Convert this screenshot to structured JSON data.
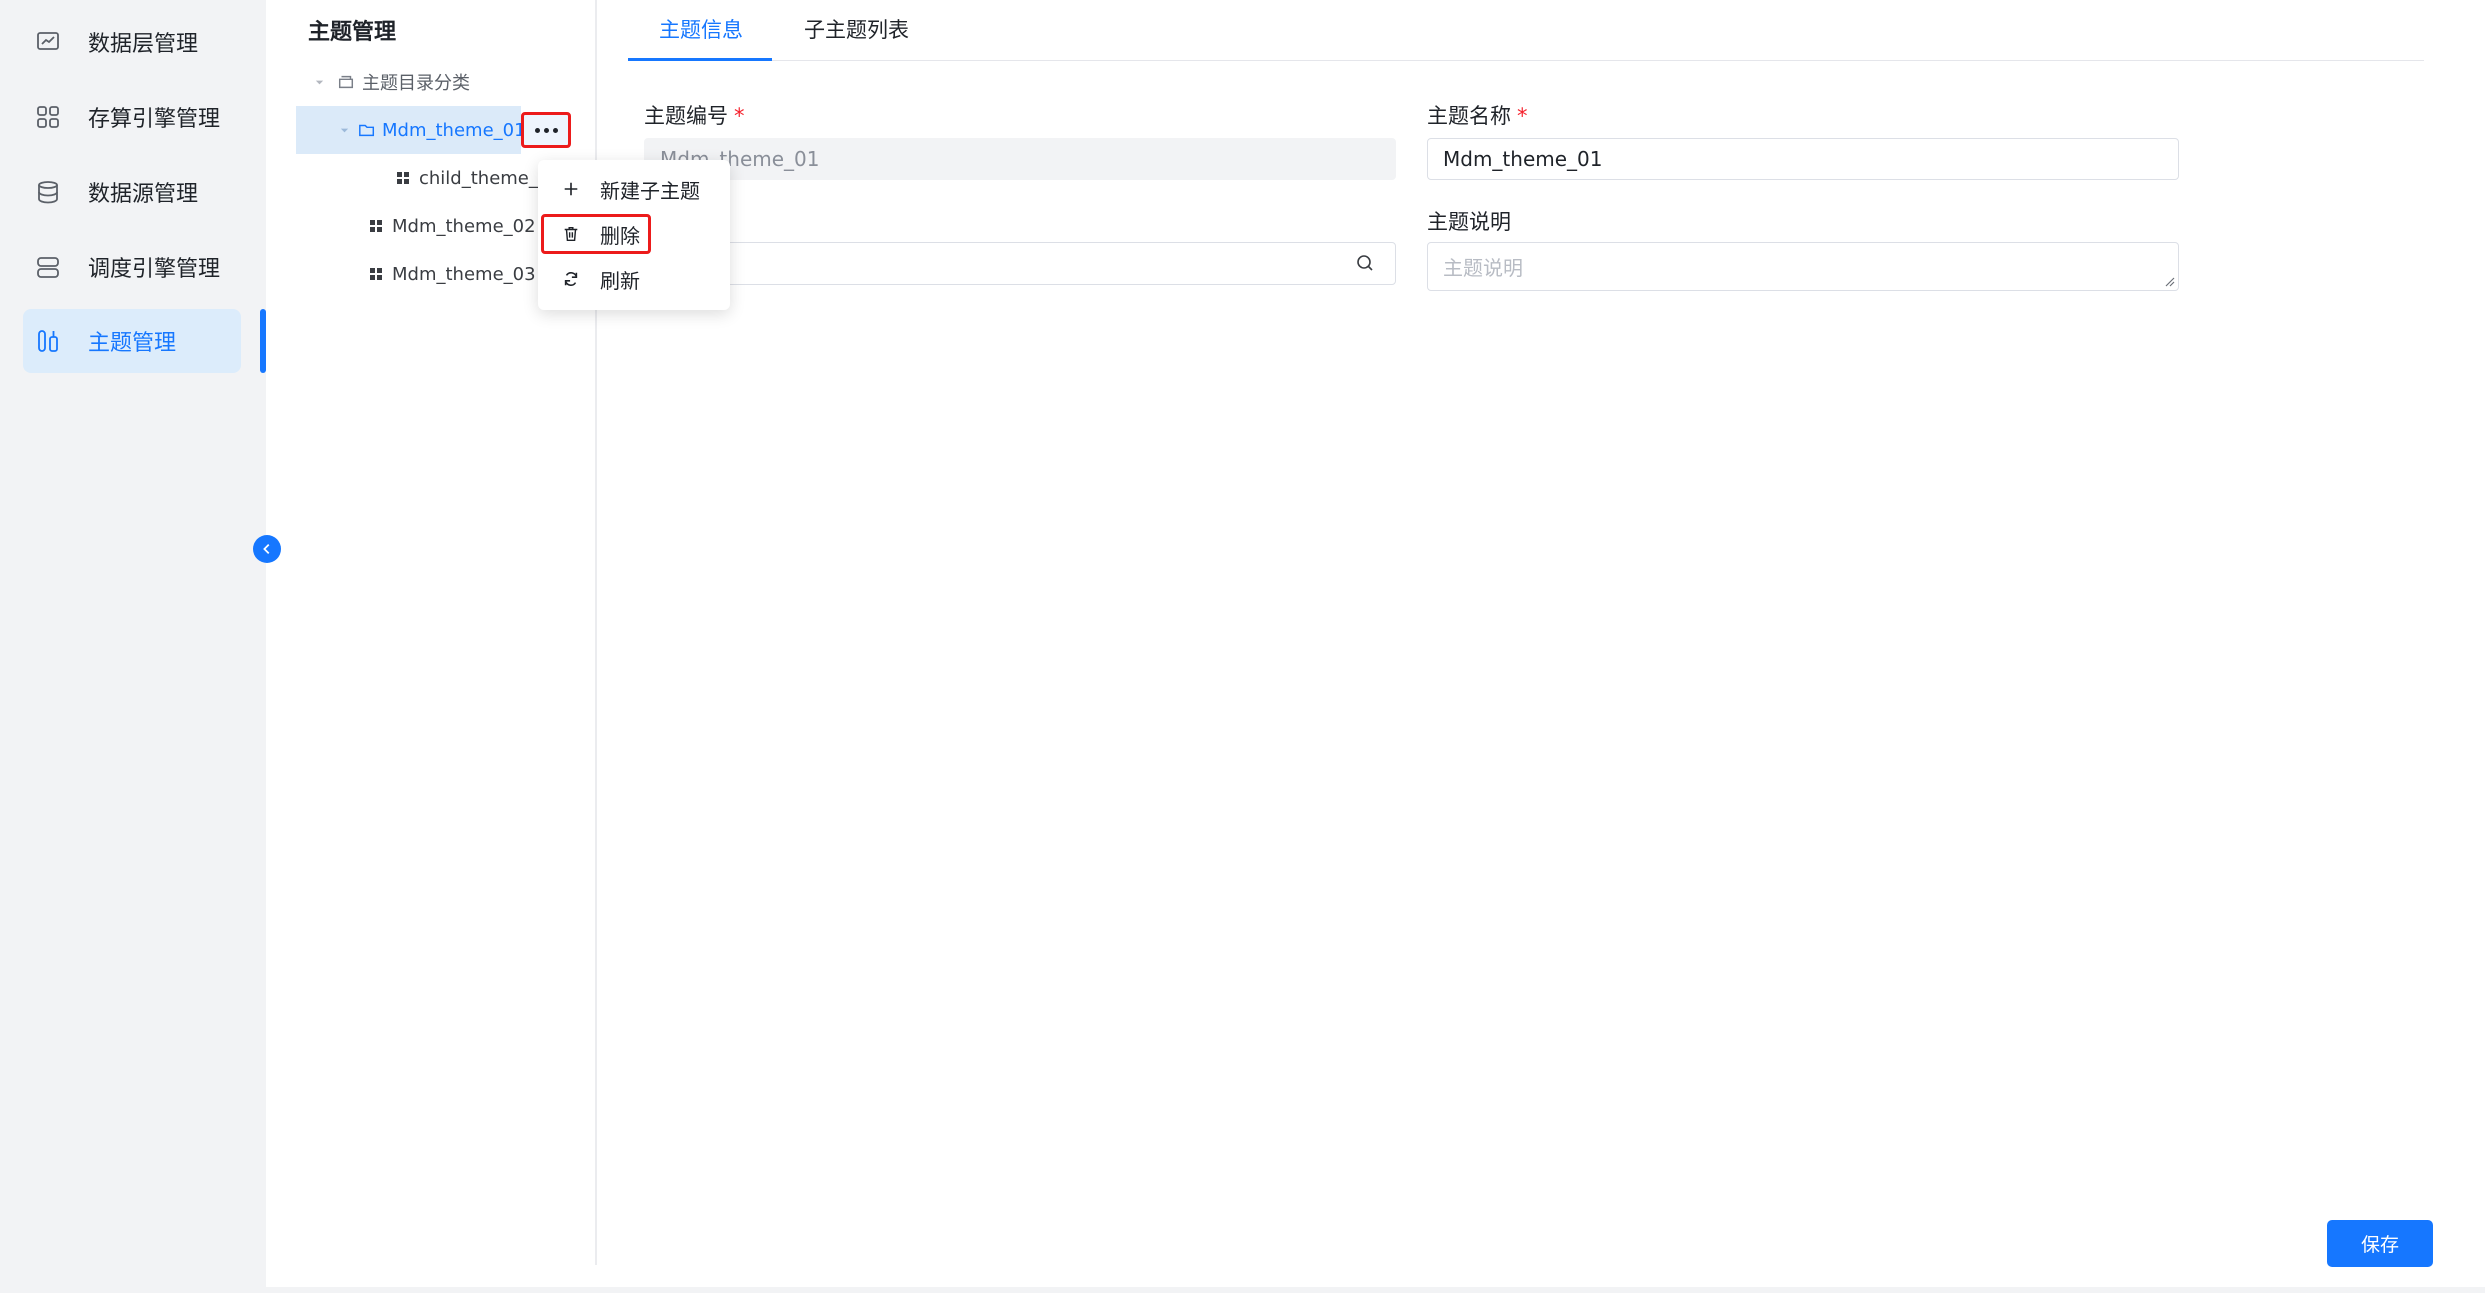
{
  "sidebar": {
    "items": [
      {
        "label": "数据层管理",
        "icon": "data-layer-icon",
        "active": false
      },
      {
        "label": "存算引擎管理",
        "icon": "engine-grid-icon",
        "active": false
      },
      {
        "label": "数据源管理",
        "icon": "database-icon",
        "active": false
      },
      {
        "label": "调度引擎管理",
        "icon": "server-icon",
        "active": false
      },
      {
        "label": "主题管理",
        "icon": "theme-tools-icon",
        "active": true
      }
    ]
  },
  "tree": {
    "title": "主题管理",
    "root": {
      "label": "主题目录分类"
    },
    "nodes": [
      {
        "label": "Mdm_theme_01",
        "selected": true
      },
      {
        "label": "child_theme_01"
      },
      {
        "label": "Mdm_theme_02"
      },
      {
        "label": "Mdm_theme_03"
      }
    ]
  },
  "context_menu": {
    "items": [
      {
        "label": "新建子主题",
        "icon": "plus-icon"
      },
      {
        "label": "删除",
        "icon": "trash-icon"
      },
      {
        "label": "刷新",
        "icon": "refresh-icon"
      }
    ]
  },
  "tabs": [
    {
      "label": "主题信息",
      "active": true
    },
    {
      "label": "子主题列表",
      "active": false
    }
  ],
  "form": {
    "code_label": "主题编号",
    "code_value": "Mdm_theme_01",
    "name_label": "主题名称",
    "name_value": "Mdm_theme_01",
    "desc_label": "主题说明",
    "desc_placeholder": "主题说明",
    "required_mark": "*"
  },
  "save_label": "保存",
  "colors": {
    "accent": "#1677ff",
    "highlight_border": "#ec1b1b",
    "required": "#f5222d"
  }
}
